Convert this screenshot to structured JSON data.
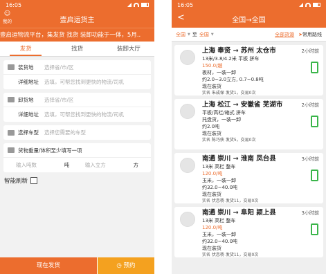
{
  "left": {
    "status": {
      "time": "16:05"
    },
    "header": {
      "title": "壹启运货主",
      "me_label": "我的"
    },
    "marquee": "壹启运物流平台，集发货 找货 装卸功能于一体，5月..",
    "tabs": [
      {
        "label": "发货"
      },
      {
        "label": "找货"
      },
      {
        "label": "装卸大厅"
      }
    ],
    "load": {
      "label": "装货地",
      "placeholder": "选择省/市/区",
      "detail_label": "详细地址",
      "detail_placeholder": "选填，可帮您找到更快的物流/司机"
    },
    "unload": {
      "label": "卸货地",
      "placeholder": "选择省/市/区",
      "detail_label": "详细地址",
      "detail_placeholder": "选填，可帮您找到更快的物流/司机"
    },
    "vehicle": {
      "label": "选择车型",
      "placeholder": "选择您需要的车型"
    },
    "cargo": {
      "label": "货物重量/体积至少填写一项",
      "weight_placeholder": "输入吨数",
      "weight_unit": "吨",
      "volume_placeholder": "输入立方",
      "volume_unit": "方"
    },
    "smart_refresh": "智能刷新",
    "buttons": {
      "ship_now": "现在发货",
      "reserve": "预约"
    }
  },
  "right": {
    "status": {
      "time": "16:05"
    },
    "header": {
      "title": "全国→全国",
      "back": "<"
    },
    "filter": {
      "from": "全国",
      "to_label": "至",
      "to": "全国",
      "all_goods": "全部货源",
      "common_routes": "常用路线"
    },
    "items": [
      {
        "route": "上海 奉贤 → 苏州 太仓市",
        "spec": "13米/3.8/4.2米 平板 拼车",
        "price": "150.0/趟",
        "goods": "板材，一装一卸",
        "weight": "约2.0~3.0立方, 0.7~0.8吨",
        "status": "现在装货",
        "meta": "实名  朱成保  发货1，交易0次",
        "time": "2小时前"
      },
      {
        "route": "上海 松江 → 安徽省 芜湖市",
        "spec": "平板/高栏/箱式 拼车",
        "price": "",
        "goods": "托盘货，一装一卸",
        "weight": "约2.0吨",
        "status": "现在装货",
        "meta": "实名  陈巧侠  发货5，交易0次",
        "time": "2小时前"
      },
      {
        "route": "南通 崇川 → 淮南 凤台县",
        "spec": "13米 高栏 整车",
        "price": "120.0/吨",
        "goods": "玉米，一装一卸",
        "weight": "约32.0~40.0吨",
        "status": "现在装货",
        "meta": "实名  伏恋杨  发货11，交易0次",
        "time": "3小时前"
      },
      {
        "route": "南通 崇川 → 阜阳 颍上县",
        "spec": "13米 高栏 整车",
        "price": "120.0/吨",
        "goods": "玉米，一装一卸",
        "weight": "约32.0~40.0吨",
        "status": "现在装货",
        "meta": "实名  伏恋杨  发货11，交易0次",
        "time": "3小时前"
      }
    ]
  },
  "colors": {
    "accent": "#ec6d2e",
    "reserve": "#f4a11f",
    "phone": "#3ab54a"
  }
}
